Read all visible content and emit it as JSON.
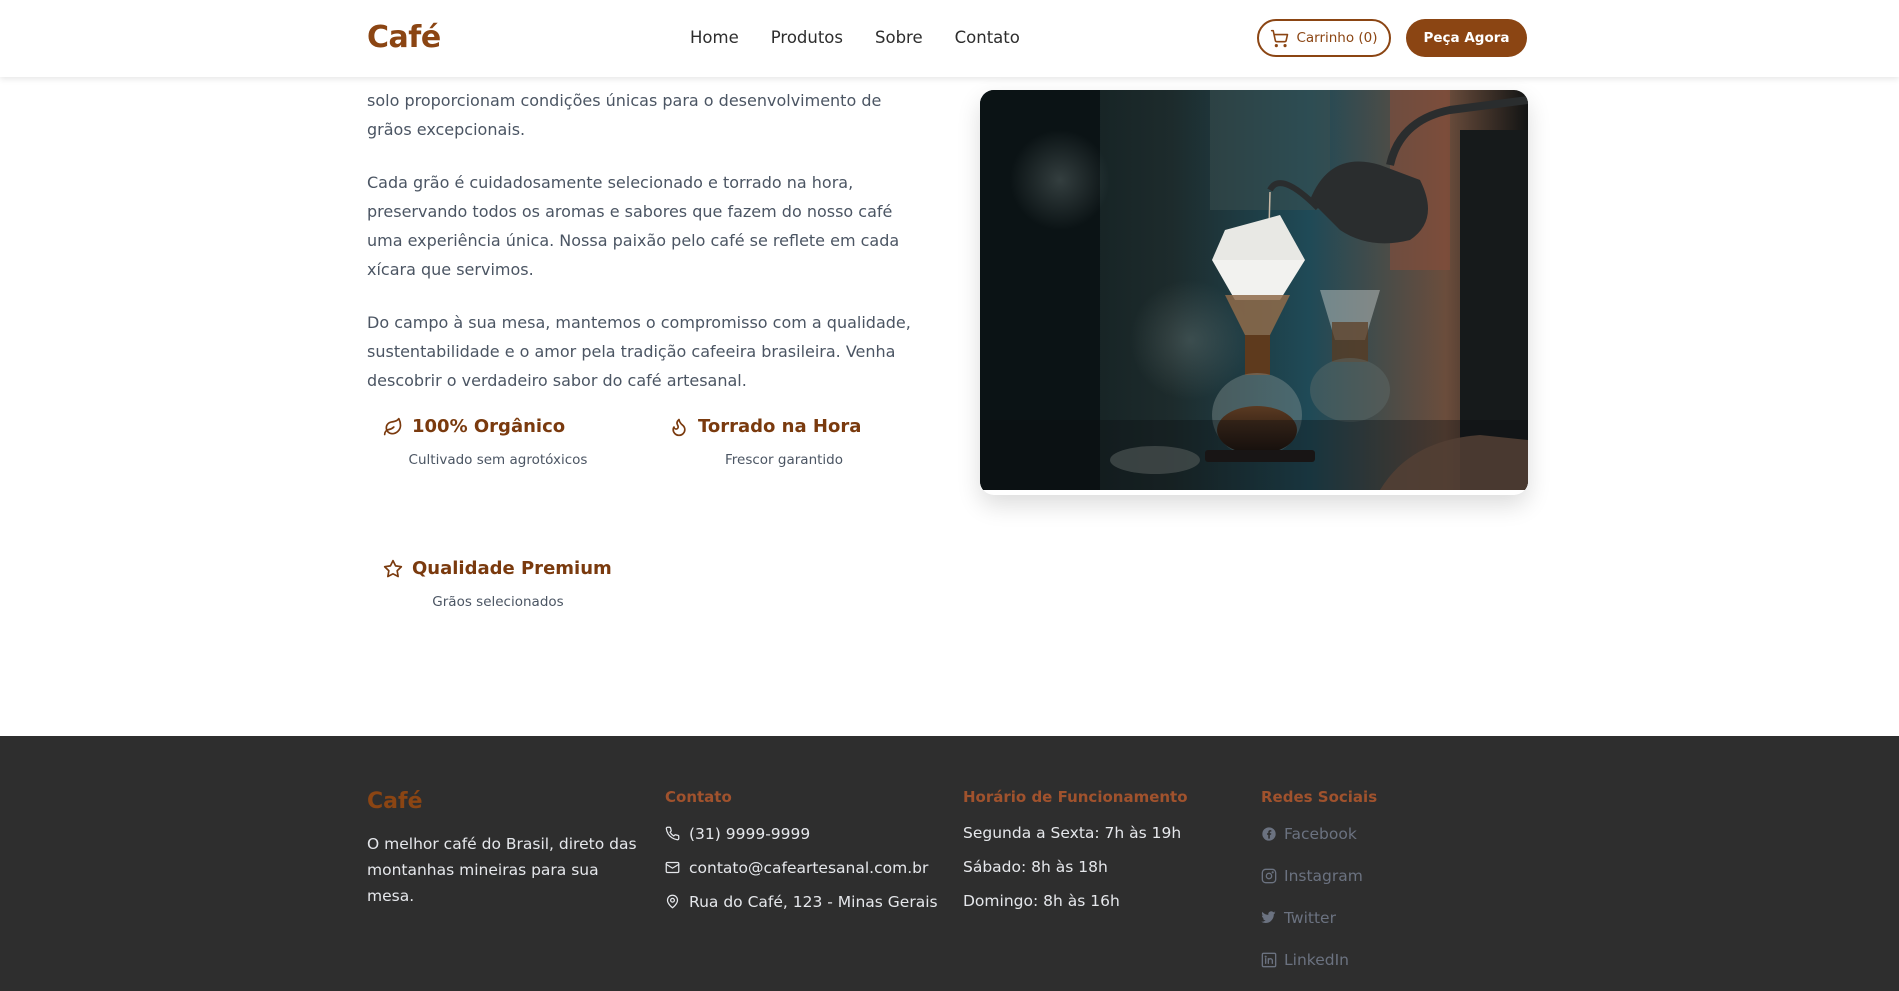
{
  "header": {
    "logo": "Café",
    "nav": [
      "Home",
      "Produtos",
      "Sobre",
      "Contato"
    ],
    "cart_label": "Carrinho (0)",
    "order_label": "Peça Agora"
  },
  "about": {
    "paragraphs": [
      "solo proporcionam condições únicas para o desenvolvimento de grãos excepcionais.",
      "Cada grão é cuidadosamente selecionado e torrado na hora, preservando todos os aromas e sabores que fazem do nosso café uma experiência única. Nossa paixão pelo café se reflete em cada xícara que servimos.",
      "Do campo à sua mesa, mantemos o compromisso com a qualidade, sustentabilidade e o amor pela tradição cafeeira brasileira. Venha descobrir o verdadeiro sabor do café artesanal."
    ],
    "features": [
      {
        "icon": "leaf-icon",
        "title": "100% Orgânico",
        "desc": "Cultivado sem agrotóxicos"
      },
      {
        "icon": "flame-icon",
        "title": "Torrado na Hora",
        "desc": "Frescor garantido"
      },
      {
        "icon": "star-icon",
        "title": "Qualidade Premium",
        "desc": "Grãos selecionados"
      }
    ]
  },
  "footer": {
    "logo": "Café",
    "tagline": "O melhor café do Brasil, direto das montanhas mineiras para sua mesa.",
    "contact": {
      "heading": "Contato",
      "phone": "(31) 9999-9999",
      "email": "contato@cafeartesanal.com.br",
      "address": "Rua do Café, 123 - Minas Gerais"
    },
    "hours": {
      "heading": "Horário de Funcionamento",
      "lines": [
        "Segunda a Sexta: 7h às 19h",
        "Sábado: 8h às 18h",
        "Domingo: 8h às 16h"
      ]
    },
    "social": {
      "heading": "Redes Sociais",
      "links": [
        "Facebook",
        "Instagram",
        "Twitter",
        "LinkedIn"
      ]
    }
  },
  "colors": {
    "brand": "#8b4513",
    "footer_bg": "#2e2e2e",
    "footer_heading": "#a0522d"
  }
}
